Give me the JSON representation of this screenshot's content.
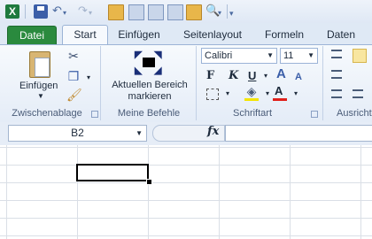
{
  "app": {
    "logo_letter": "X"
  },
  "tabs": [
    {
      "label": "Datei"
    },
    {
      "label": "Start"
    },
    {
      "label": "Einfügen"
    },
    {
      "label": "Seitenlayout"
    },
    {
      "label": "Formeln"
    },
    {
      "label": "Daten"
    }
  ],
  "ribbon": {
    "clipboard": {
      "paste_label": "Einfügen",
      "group_label": "Zwischenablage"
    },
    "my_commands": {
      "button_label_line1": "Aktuellen Bereich",
      "button_label_line2": "markieren",
      "group_label": "Meine Befehle"
    },
    "font": {
      "font_name": "Calibri",
      "font_size": "11",
      "bold": "F",
      "italic": "K",
      "underline": "U",
      "font_color_letter": "A",
      "group_label": "Schriftart"
    },
    "alignment": {
      "group_label": "Ausricht"
    }
  },
  "formula_bar": {
    "name_box": "B2",
    "fx": "fx",
    "formula": ""
  },
  "colors": {
    "file_tab": "#2a8a3e",
    "accent": "#9bb3d6",
    "font_color_bar": "#e0201a",
    "fill_color_bar": "#f4e400"
  },
  "icons": [
    "excel-logo-icon",
    "save-icon",
    "undo-icon",
    "redo-icon",
    "open-folder-icon",
    "cut-icon",
    "copy-icon",
    "format-painter-icon",
    "select-region-icon",
    "border-icon",
    "fill-color-icon",
    "font-color-icon"
  ]
}
